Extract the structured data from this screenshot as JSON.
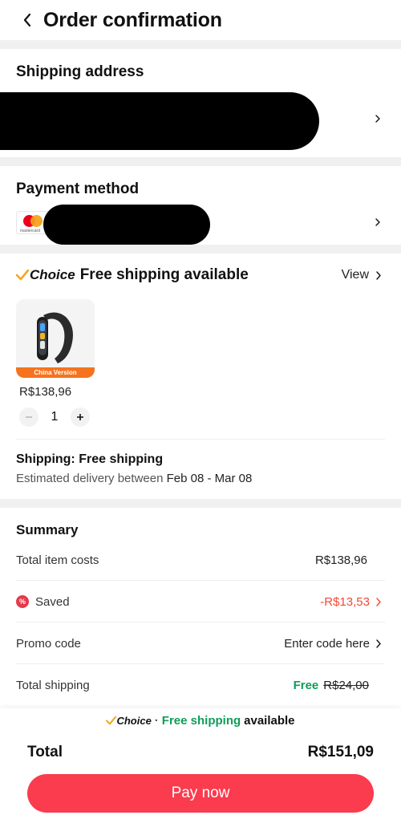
{
  "header": {
    "title": "Order confirmation"
  },
  "shipping_address": {
    "title": "Shipping address"
  },
  "payment_method": {
    "title": "Payment method",
    "card_brand": "mastercard"
  },
  "item_section": {
    "choice_label": "Choice",
    "title": "Free shipping available",
    "view_label": "View",
    "product": {
      "badge": "China Version",
      "price": "R$138,96",
      "quantity": "1"
    },
    "shipping_line": "Shipping: Free shipping",
    "eta_prefix": "Estimated delivery between",
    "eta_dates": "Feb 08 - Mar 08"
  },
  "summary": {
    "title": "Summary",
    "total_items_label": "Total item costs",
    "total_items_value": "R$138,96",
    "saved_label": "Saved",
    "saved_value": "-R$13,53",
    "promo_label": "Promo code",
    "promo_value": "Enter code here",
    "shipping_label": "Total shipping",
    "shipping_free": "Free",
    "shipping_original": "R$24,00"
  },
  "bottom_bar": {
    "banner_choice": "Choice",
    "banner_dot": "·",
    "banner_free": "Free shipping",
    "banner_suffix": "available",
    "total_label": "Total",
    "total_value": "R$151,09",
    "pay_button": "Pay now"
  },
  "colors": {
    "accent_red": "#fb3b4e",
    "saved_red": "#f24a35",
    "free_green": "#0f9d58",
    "choice_orange": "#f5a623"
  }
}
